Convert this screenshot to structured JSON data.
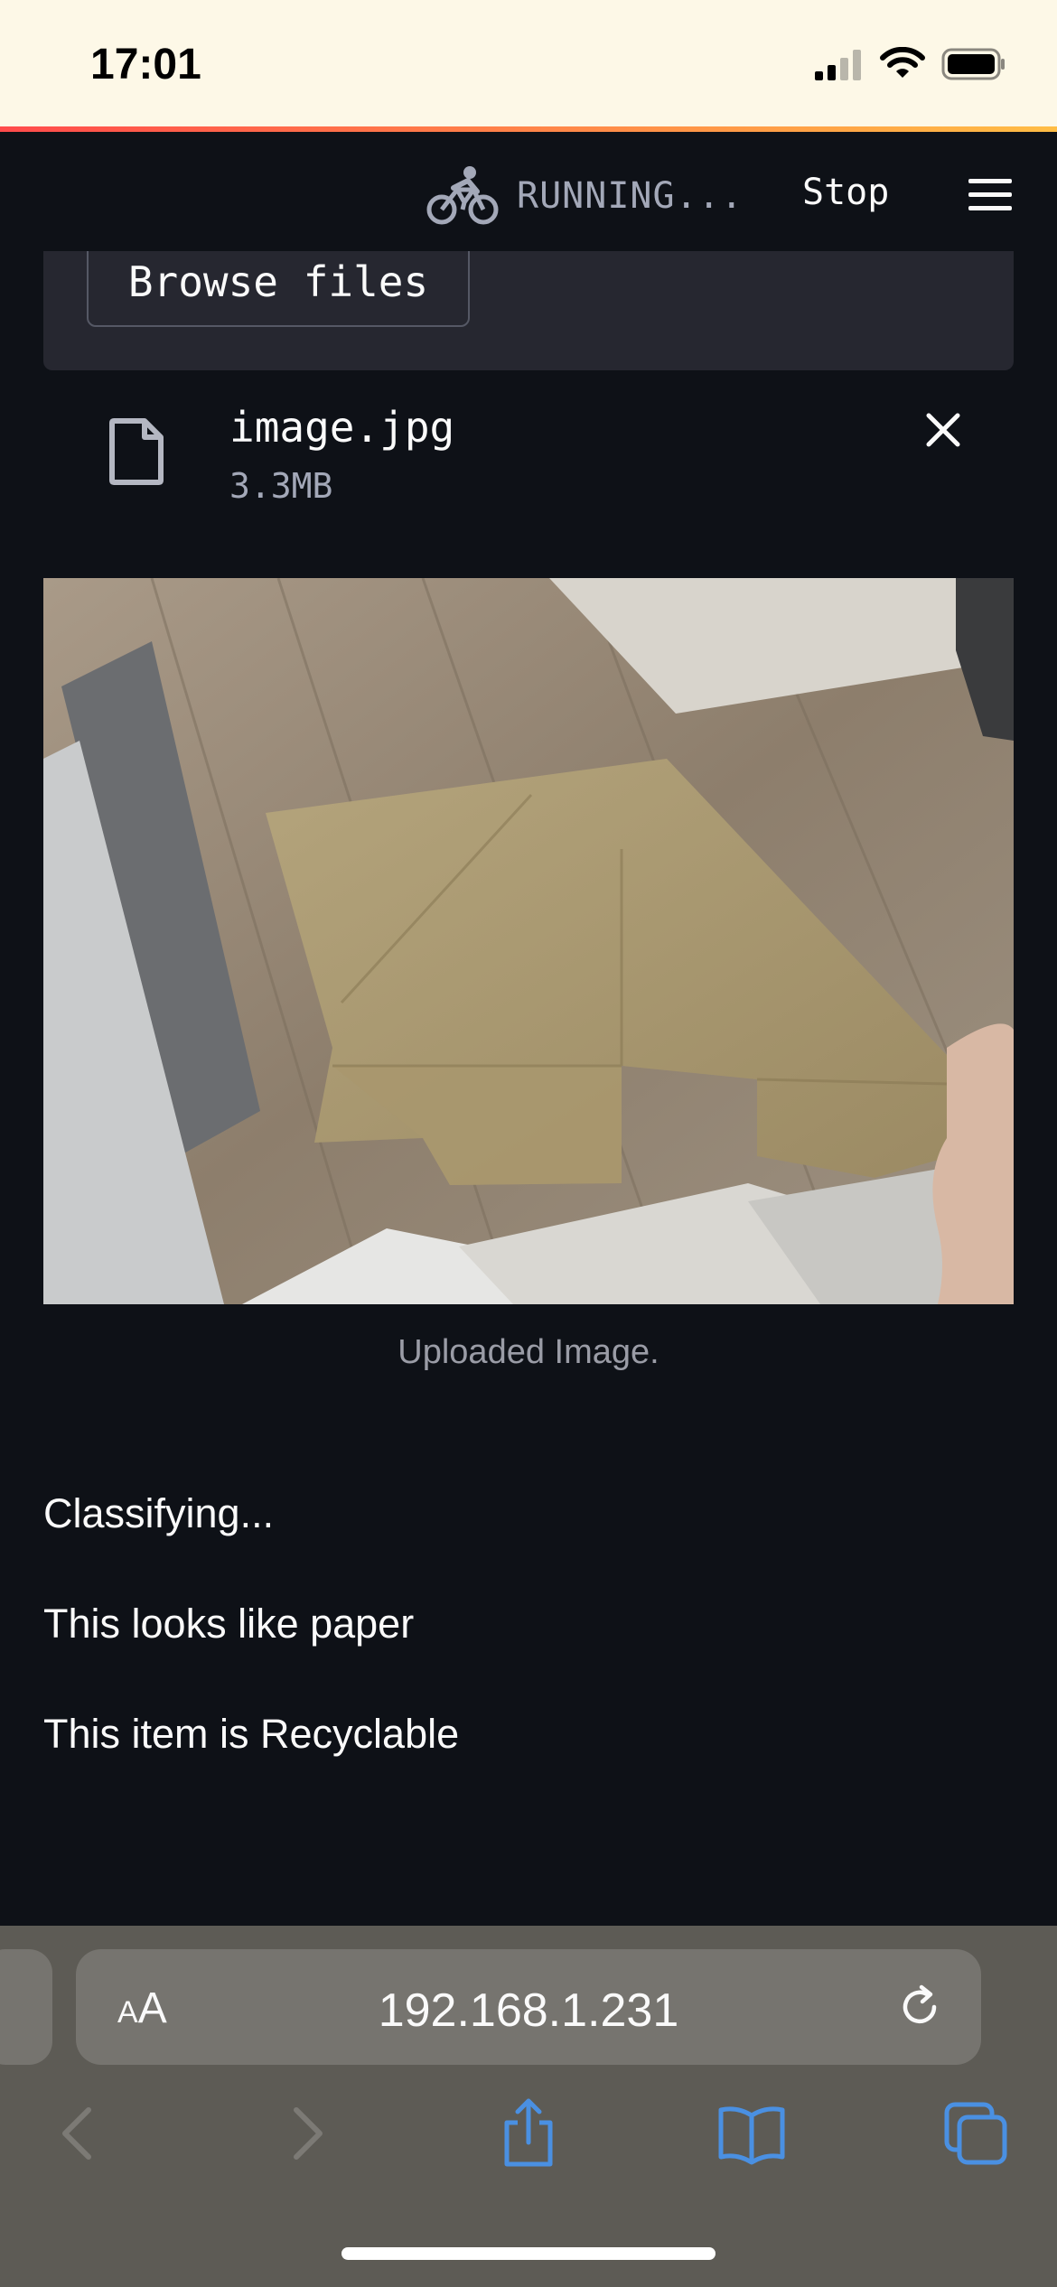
{
  "status_bar": {
    "time": "17:01"
  },
  "app_header": {
    "status_text": "RUNNING...",
    "stop_label": "Stop"
  },
  "uploader": {
    "browse_label": "Browse files",
    "file": {
      "name": "image.jpg",
      "size": "3.3MB"
    }
  },
  "image": {
    "caption": "Uploaded Image."
  },
  "results": {
    "line1": "Classifying...",
    "line2": "This looks like paper",
    "line3": "This item is Recyclable"
  },
  "browser": {
    "aa_small": "A",
    "aa_large": "A",
    "url": "192.168.1.231"
  },
  "colors": {
    "background": "#0e1117",
    "secondary_bg": "#262730",
    "status_bar_bg": "#fdf8e7",
    "safari_toolbar": "#5d5b55",
    "safari_accent": "#4a90e2"
  },
  "icons": {
    "running": "bicycle-icon",
    "menu": "hamburger-menu-icon",
    "file": "file-icon",
    "close": "close-icon",
    "reload": "reload-icon",
    "back": "chevron-left-icon",
    "forward": "chevron-right-icon",
    "share": "share-icon",
    "bookmarks": "book-icon",
    "tabs": "tabs-icon"
  }
}
